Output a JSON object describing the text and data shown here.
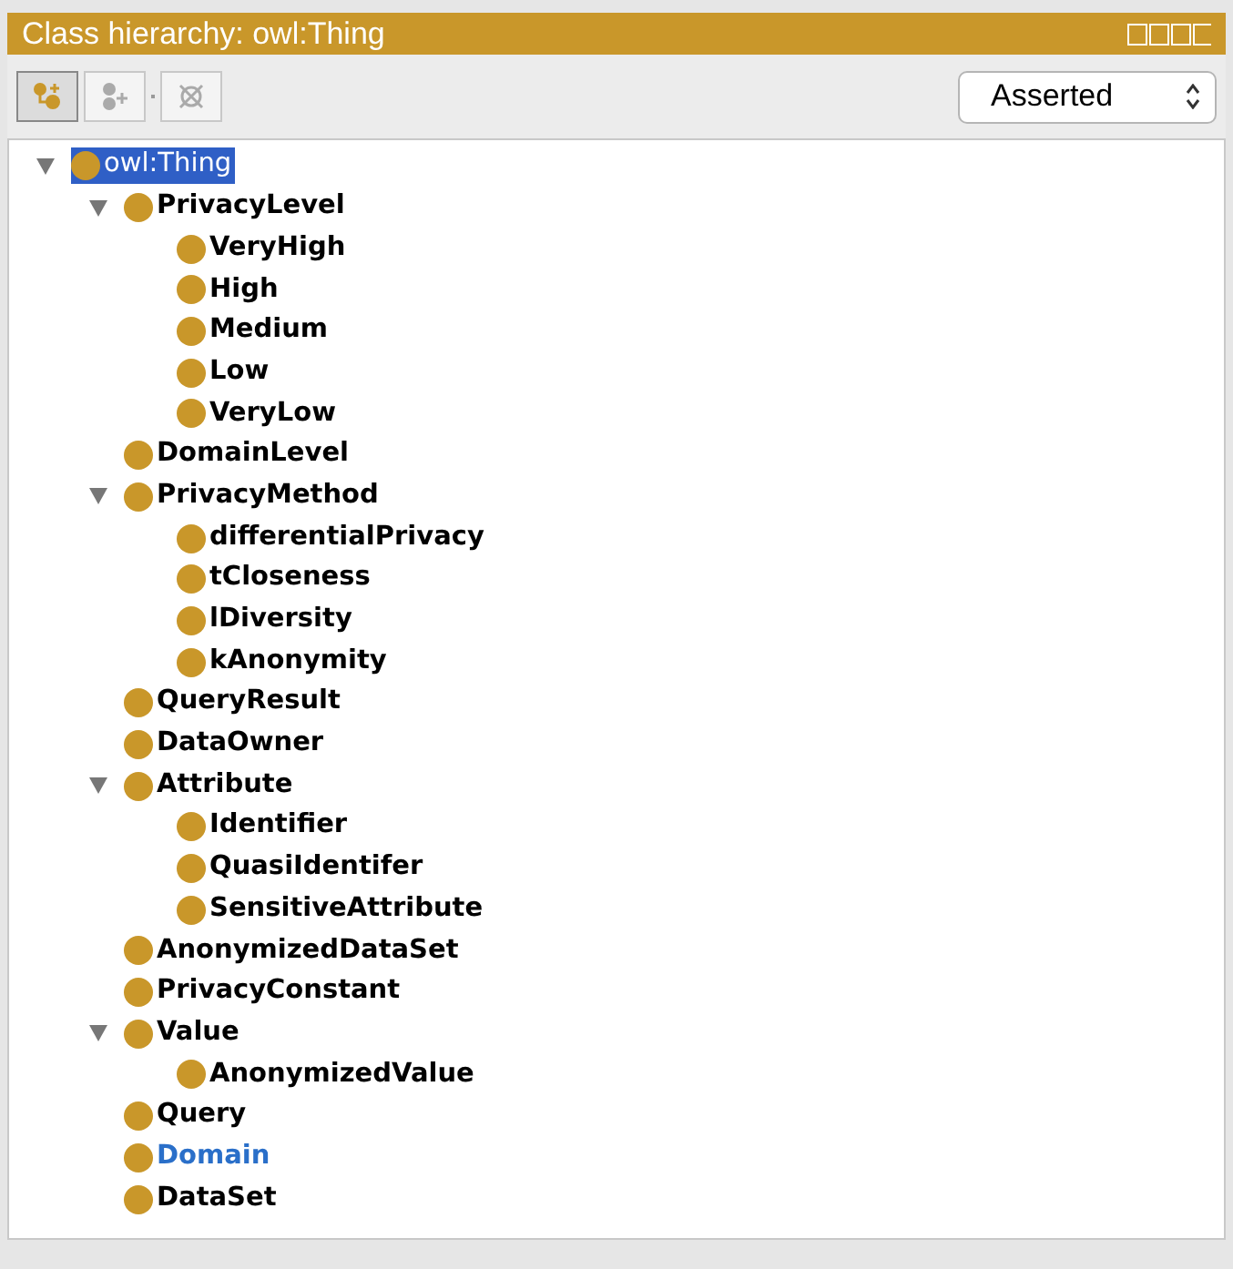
{
  "panel": {
    "title": "Class hierarchy: owl:Thing"
  },
  "toolbar": [
    {
      "selected": true
    },
    {
      "selected": false
    },
    {
      "selected": false
    }
  ],
  "view_select": {
    "value": "Asserted"
  },
  "tree": [
    {
      "label": "owl:Thing",
      "selected": true,
      "highlighted": false,
      "children": [
        {
          "label": "PrivacyLevel",
          "selected": false,
          "highlighted": false,
          "children": [
            {
              "label": "VeryHigh",
              "selected": false,
              "highlighted": false
            },
            {
              "label": "High",
              "selected": false,
              "highlighted": false
            },
            {
              "label": "Medium",
              "selected": false,
              "highlighted": false
            },
            {
              "label": "Low",
              "selected": false,
              "highlighted": false
            },
            {
              "label": "VeryLow",
              "selected": false,
              "highlighted": false
            }
          ]
        },
        {
          "label": "DomainLevel",
          "selected": false,
          "highlighted": false
        },
        {
          "label": "PrivacyMethod",
          "selected": false,
          "highlighted": false,
          "children": [
            {
              "label": "differentialPrivacy",
              "selected": false,
              "highlighted": false
            },
            {
              "label": "tCloseness",
              "selected": false,
              "highlighted": false
            },
            {
              "label": "lDiversity",
              "selected": false,
              "highlighted": false
            },
            {
              "label": "kAnonymity",
              "selected": false,
              "highlighted": false
            }
          ]
        },
        {
          "label": "QueryResult",
          "selected": false,
          "highlighted": false
        },
        {
          "label": "DataOwner",
          "selected": false,
          "highlighted": false
        },
        {
          "label": "Attribute",
          "selected": false,
          "highlighted": false,
          "children": [
            {
              "label": "Identifier",
              "selected": false,
              "highlighted": false
            },
            {
              "label": "QuasiIdentifer",
              "selected": false,
              "highlighted": false
            },
            {
              "label": "SensitiveAttribute",
              "selected": false,
              "highlighted": false
            }
          ]
        },
        {
          "label": "AnonymizedDataSet",
          "selected": false,
          "highlighted": false
        },
        {
          "label": "PrivacyConstant",
          "selected": false,
          "highlighted": false
        },
        {
          "label": "Value",
          "selected": false,
          "highlighted": false,
          "children": [
            {
              "label": "AnonymizedValue",
              "selected": false,
              "highlighted": false
            }
          ]
        },
        {
          "label": "Query",
          "selected": false,
          "highlighted": false
        },
        {
          "label": "Domain",
          "selected": false,
          "highlighted": true
        },
        {
          "label": "DataSet",
          "selected": false,
          "highlighted": false
        }
      ]
    }
  ]
}
